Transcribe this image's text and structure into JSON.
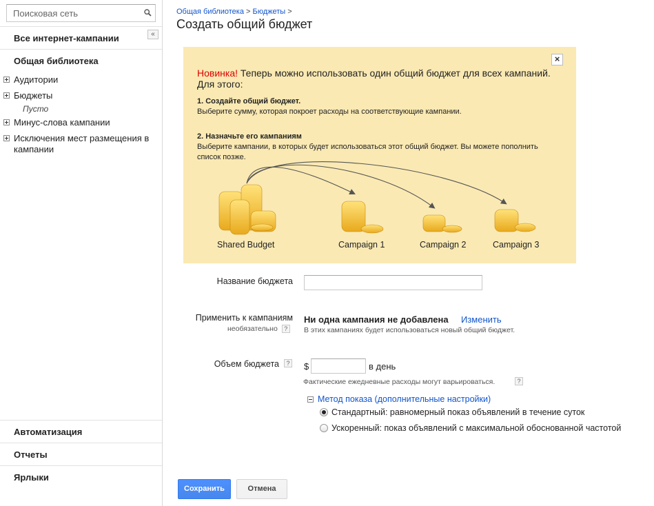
{
  "sidebar": {
    "search_placeholder": "Поисковая сеть",
    "all_campaigns": "Все интернет-кампании",
    "collapse_glyph": "«",
    "shared_library": "Общая библиотека",
    "tree": [
      {
        "label": "Аудитории"
      },
      {
        "label": "Бюджеты"
      },
      {
        "label": "Минус-слова кампании"
      },
      {
        "label": "Исключения мест размещения в кампании"
      }
    ],
    "budgets_empty": "Пусто",
    "bottom": [
      "Автоматизация",
      "Отчеты",
      "Ярлыки"
    ]
  },
  "header": {
    "crumb1": "Общая библиотека",
    "sep1": " > ",
    "crumb2": "Бюджеты",
    "sep2": " >",
    "title": "Создать общий бюджет"
  },
  "promo": {
    "close": "×",
    "new_label": "Новинка!",
    "intro": " Теперь можно использовать один общий бюджет для всех кампаний. Для этого:",
    "step1_title": "1. Создайте общий бюджет.",
    "step1_text": "Выберите сумму, которая покроет расходы на соответствующие кампании.",
    "step2_title": "2. Назначьте его кампаниям",
    "step2_text": "Выберите кампании, в которых будет использоваться этот общий бюджет. Вы можете пополнить список позже.",
    "labels": [
      "Shared Budget",
      "Campaign 1",
      "Campaign 2",
      "Campaign 3"
    ]
  },
  "form": {
    "name_label": "Название бюджета",
    "name_value": "",
    "apply_label": "Применить к кампаниям",
    "optional": "необязательно",
    "help": "?",
    "no_campaign": "Ни одна кампания не добавлена",
    "change": "Изменить",
    "apply_note": "В этих кампаниях будет использоваться новый общий бюджет.",
    "amount_label": "Объем бюджета",
    "currency": "$",
    "amount_value": "",
    "per_day": "в день",
    "amount_note": "Фактические ежедневные расходы могут варьироваться.",
    "delivery_toggle": "Метод показа (дополнительные настройки)",
    "delivery_options": [
      {
        "label": "Стандартный: равномерный показ объявлений в течение суток",
        "checked": true
      },
      {
        "label": "Ускоренный: показ объявлений с максимальной обоснованной частотой",
        "checked": false
      }
    ]
  },
  "buttons": {
    "save": "Сохранить",
    "cancel": "Отмена"
  },
  "colors": {
    "link": "#1155cc",
    "promo_bg": "#fae9b3",
    "save_bg": "#4d90fe",
    "new_red": "#dd0000"
  }
}
